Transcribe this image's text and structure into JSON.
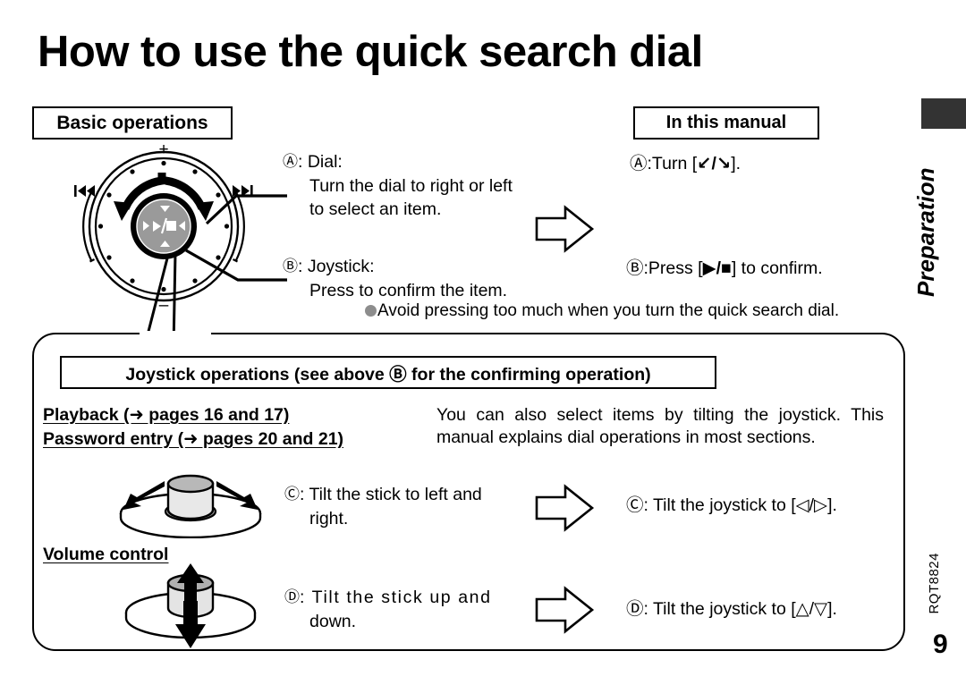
{
  "document": {
    "title": "How to use the quick search dial",
    "page_number": "9",
    "doc_code": "RQT8824",
    "side_tab_label": "Preparation"
  },
  "basic_operations": {
    "section_label": "Basic operations",
    "dial": {
      "marker": "Ⓐ",
      "heading": ": Dial:",
      "line1": "Turn the dial to right or left",
      "line2": "to select an item."
    },
    "joystick": {
      "marker": "Ⓑ",
      "heading": ": Joystick:",
      "line1": "Press to confirm the item."
    },
    "note": "Avoid pressing too much when you turn the quick search dial.",
    "dial_diagram": {
      "plus_label": "+",
      "minus_label": "–",
      "skip_back_icon": "skip-backward-icon",
      "skip_forward_icon": "skip-forward-icon",
      "center_glyph": "play-stop-icon"
    }
  },
  "in_this_manual": {
    "section_label": "In this manual",
    "line_a_prefix": "Ⓐ:Turn [",
    "line_a_glyph": "↙/↘",
    "line_a_suffix": "].",
    "line_b_prefix": "Ⓑ:Press [",
    "line_b_glyph": "▶/■",
    "line_b_suffix": "] to confirm."
  },
  "joystick_operations": {
    "section_label": "Joystick operations (see above Ⓑ for the confirming operation)",
    "playback_link": "Playback (➜ pages 16 and 17)",
    "password_link": "Password entry (➜ pages 20 and 21)",
    "description": "You can also select items by tilting the joystick. This manual explains dial operations in most sections.",
    "volume_label": "Volume control",
    "row_c": {
      "left_marker": "Ⓒ",
      "left_text": ": Tilt the stick to left and",
      "left_text2": "right.",
      "right_prefix": "Ⓒ: Tilt the joystick to [",
      "right_glyph": "◁/▷",
      "right_suffix": "]."
    },
    "row_d": {
      "left_marker": "Ⓓ",
      "left_text": ": Tilt the stick up and",
      "left_text2": "down.",
      "right_prefix": "Ⓓ: Tilt the joystick to [",
      "right_glyph": "△/▽",
      "right_suffix": "]."
    }
  },
  "colors": {
    "knob_gray": "#9a9a9a",
    "bullet_gray": "#8d8d8d",
    "tab_dark": "#333333",
    "ink": "#000000"
  }
}
